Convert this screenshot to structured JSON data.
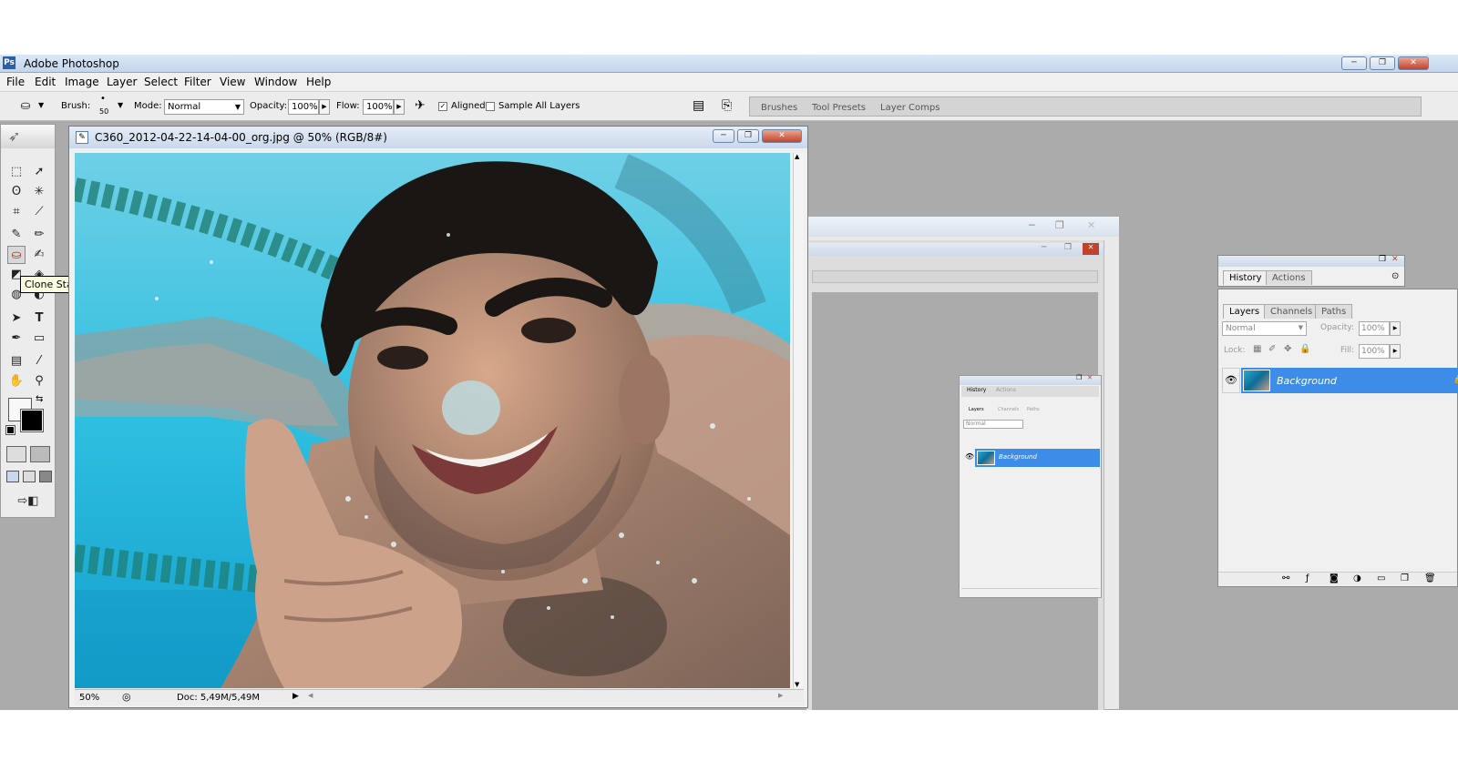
{
  "app": {
    "title": "Adobe Photoshop"
  },
  "window_buttons": {
    "minimize": "─",
    "restore": "❐",
    "close": "✕"
  },
  "menu": [
    "File",
    "Edit",
    "Image",
    "Layer",
    "Select",
    "Filter",
    "View",
    "Window",
    "Help"
  ],
  "options": {
    "brush_label": "Brush:",
    "brush_size": "50",
    "mode_label": "Mode:",
    "mode_value": "Normal",
    "opacity_label": "Opacity:",
    "opacity_value": "100%",
    "flow_label": "Flow:",
    "flow_value": "100%",
    "aligned_label": "Aligned",
    "aligned_checked": true,
    "sample_all_label": "Sample All Layers",
    "sample_all_checked": false
  },
  "palette_well": {
    "tabs": [
      "Brushes",
      "Tool Presets",
      "Layer Comps"
    ]
  },
  "tooltip": "Clone Stamp Tool (S)",
  "document": {
    "title": "C360_2012-04-22-14-04-00_org.jpg @ 50% (RGB/8#)",
    "zoom": "50%",
    "doc_size": "Doc: 5,49M/5,49M"
  },
  "history_panel": {
    "tabs": [
      "History",
      "Actions"
    ]
  },
  "layers_panel": {
    "tabs": [
      "Layers",
      "Channels",
      "Paths"
    ],
    "blend_mode": "Normal",
    "opacity_label": "Opacity:",
    "opacity_value": "100%",
    "lock_label": "Lock:",
    "fill_label": "Fill:",
    "fill_value": "100%",
    "layer_name": "Background"
  },
  "mini_panel": {
    "history_tabs": [
      "History",
      "Actions"
    ],
    "layers_tabs": [
      "Layers",
      "Channels",
      "Paths"
    ],
    "blend_mode": "Normal",
    "layer_name": "Background"
  },
  "colors": {
    "accent": "#3d8ce8",
    "workspace": "#ababab",
    "titlebar": "#c3d6ec"
  }
}
